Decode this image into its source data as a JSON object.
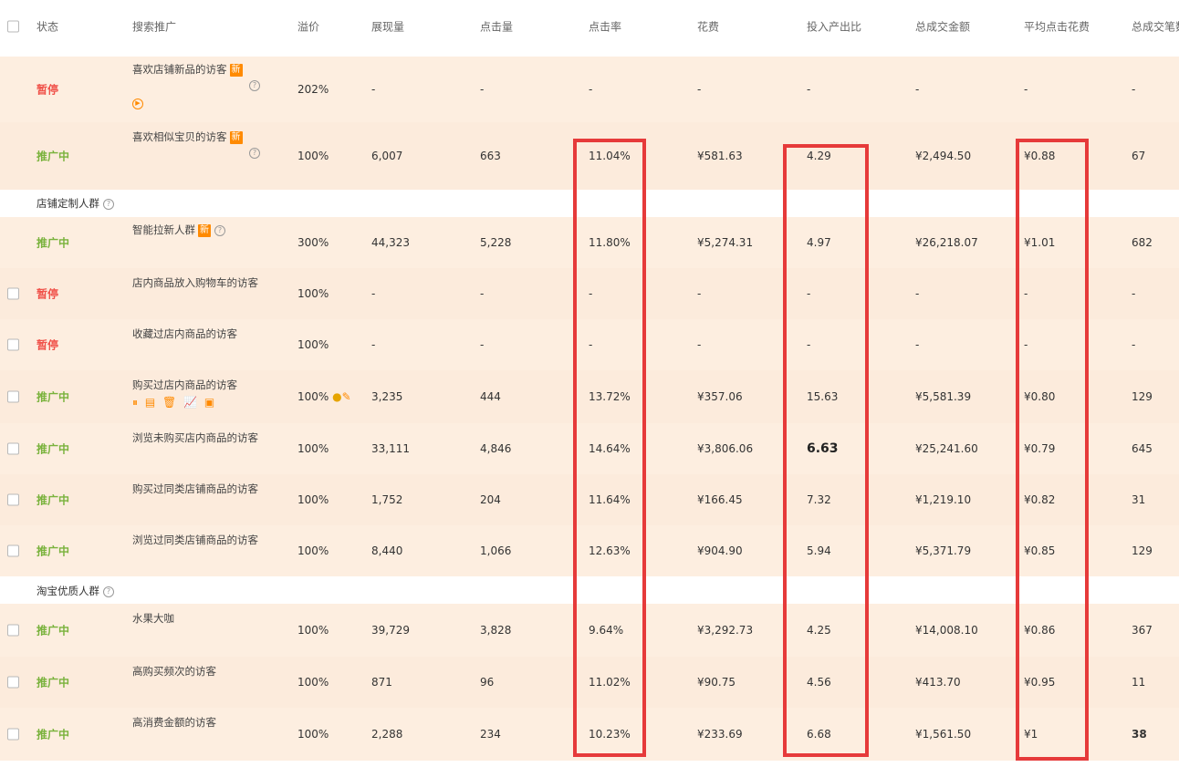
{
  "header": {
    "status": "状态",
    "search_promo": "搜索推广",
    "premium": "溢价",
    "impressions": "展现量",
    "clicks": "点击量",
    "ctr": "点击率",
    "cost": "花费",
    "roi": "投入产出比",
    "gmv": "总成交金额",
    "avg_cpc": "平均点击花费",
    "orders": "总成交笔数"
  },
  "groups": {
    "shop_custom": "店铺定制人群",
    "taobao_quality": "淘宝优质人群"
  },
  "badges": {
    "new": "新"
  },
  "rows": [
    {
      "status": "暂停",
      "audience": "喜欢店铺新品的访客",
      "premium": "202%",
      "impressions": "-",
      "clicks": "-",
      "ctr": "-",
      "cost": "-",
      "roi": "-",
      "gmv": "-",
      "avg_cpc": "-",
      "orders": "-"
    },
    {
      "status": "推广中",
      "audience": "喜欢相似宝贝的访客",
      "premium": "100%",
      "impressions": "6,007",
      "clicks": "663",
      "ctr": "11.04%",
      "cost": "¥581.63",
      "roi": "4.29",
      "gmv": "¥2,494.50",
      "avg_cpc": "¥0.88",
      "orders": "67"
    },
    {
      "status": "推广中",
      "audience": "智能拉新人群",
      "premium": "300%",
      "impressions": "44,323",
      "clicks": "5,228",
      "ctr": "11.80%",
      "cost": "¥5,274.31",
      "roi": "4.97",
      "gmv": "¥26,218.07",
      "avg_cpc": "¥1.01",
      "orders": "682"
    },
    {
      "status": "暂停",
      "audience": "店内商品放入购物车的访客",
      "premium": "100%",
      "impressions": "-",
      "clicks": "-",
      "ctr": "-",
      "cost": "-",
      "roi": "-",
      "gmv": "-",
      "avg_cpc": "-",
      "orders": "-"
    },
    {
      "status": "暂停",
      "audience": "收藏过店内商品的访客",
      "premium": "100%",
      "impressions": "-",
      "clicks": "-",
      "ctr": "-",
      "cost": "-",
      "roi": "-",
      "gmv": "-",
      "avg_cpc": "-",
      "orders": "-"
    },
    {
      "status": "推广中",
      "audience": "购买过店内商品的访客",
      "premium": "100%",
      "impressions": "3,235",
      "clicks": "444",
      "ctr": "13.72%",
      "cost": "¥357.06",
      "roi": "15.63",
      "gmv": "¥5,581.39",
      "avg_cpc": "¥0.80",
      "orders": "129"
    },
    {
      "status": "推广中",
      "audience": "浏览未购买店内商品的访客",
      "premium": "100%",
      "impressions": "33,111",
      "clicks": "4,846",
      "ctr": "14.64%",
      "cost": "¥3,806.06",
      "roi": "6.63",
      "gmv": "¥25,241.60",
      "avg_cpc": "¥0.79",
      "orders": "645"
    },
    {
      "status": "推广中",
      "audience": "购买过同类店铺商品的访客",
      "premium": "100%",
      "impressions": "1,752",
      "clicks": "204",
      "ctr": "11.64%",
      "cost": "¥166.45",
      "roi": "7.32",
      "gmv": "¥1,219.10",
      "avg_cpc": "¥0.82",
      "orders": "31"
    },
    {
      "status": "推广中",
      "audience": "浏览过同类店铺商品的访客",
      "premium": "100%",
      "impressions": "8,440",
      "clicks": "1,066",
      "ctr": "12.63%",
      "cost": "¥904.90",
      "roi": "5.94",
      "gmv": "¥5,371.79",
      "avg_cpc": "¥0.85",
      "orders": "129"
    },
    {
      "status": "推广中",
      "audience": "水果大咖",
      "premium": "100%",
      "impressions": "39,729",
      "clicks": "3,828",
      "ctr": "9.64%",
      "cost": "¥3,292.73",
      "roi": "4.25",
      "gmv": "¥14,008.10",
      "avg_cpc": "¥0.86",
      "orders": "367"
    },
    {
      "status": "推广中",
      "audience": "高购买频次的访客",
      "premium": "100%",
      "impressions": "871",
      "clicks": "96",
      "ctr": "11.02%",
      "cost": "¥90.75",
      "roi": "4.56",
      "gmv": "¥413.70",
      "avg_cpc": "¥0.95",
      "orders": "11"
    },
    {
      "status": "推广中",
      "audience": "高消费金额的访客",
      "premium": "100%",
      "impressions": "2,288",
      "clicks": "234",
      "ctr": "10.23%",
      "cost": "¥233.69",
      "roi": "6.68",
      "gmv": "¥1,561.50",
      "avg_cpc": "¥1",
      "orders": "38"
    }
  ],
  "icons": [
    "help-icon",
    "play-icon",
    "pause-icon",
    "clipboard-icon",
    "delete-icon",
    "chart-icon",
    "report-icon",
    "person-icon",
    "edit-icon",
    "checkbox-icon"
  ],
  "colors": {
    "row_bg": "#fdeee0",
    "paused": "#f0524a",
    "running": "#79b23c",
    "badge": "#ff8a00",
    "highlight_box": "#e63a3a"
  }
}
